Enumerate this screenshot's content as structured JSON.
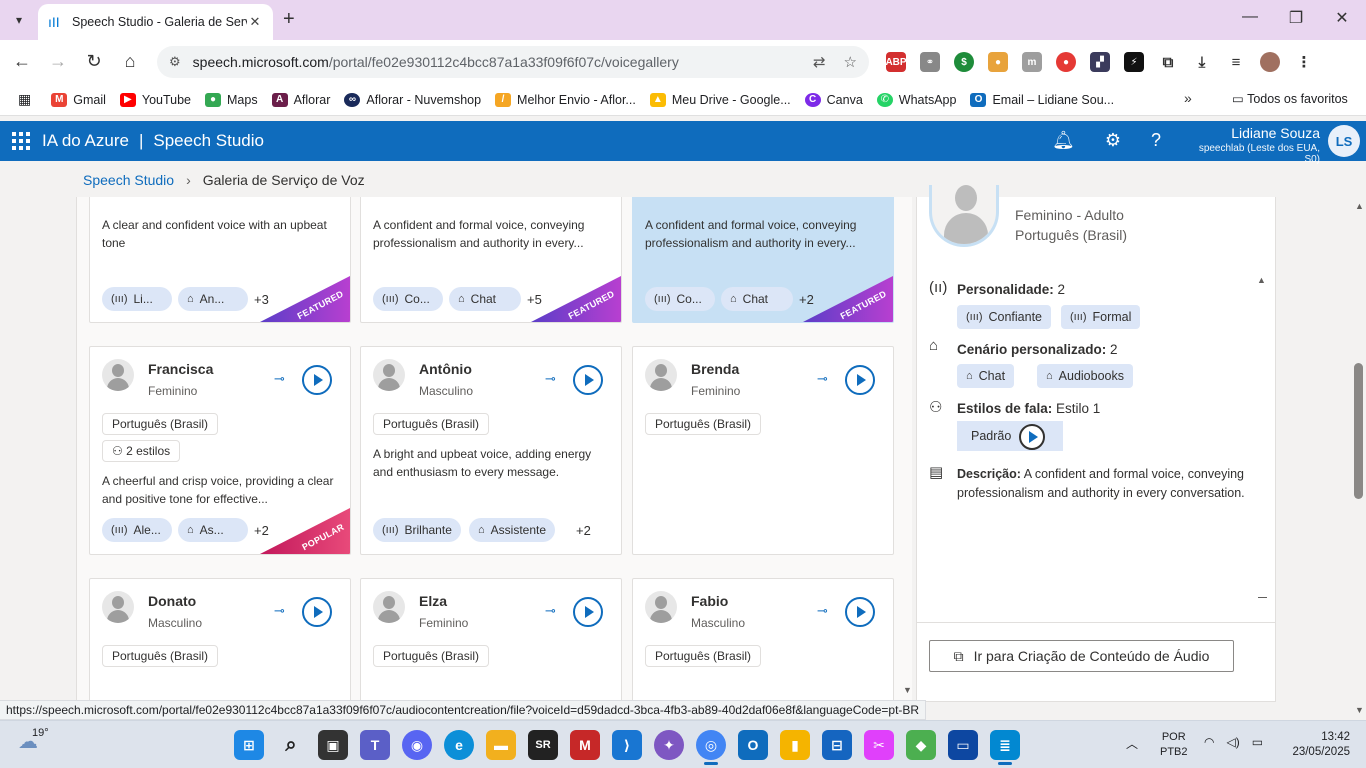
{
  "browser": {
    "tab_title": "Speech Studio - Galeria de Serv",
    "url_host": "speech.microsoft.com",
    "url_path": "/portal/fe02e930112c4bcc87a1a33f09f6f07c/voicegallery",
    "bookmarks": [
      {
        "label": "Gmail",
        "color": "#ea4335",
        "icon": "gmail-icon"
      },
      {
        "label": "YouTube",
        "color": "#ff0000",
        "icon": "youtube-icon"
      },
      {
        "label": "Maps",
        "color": "#34a853",
        "icon": "maps-icon"
      },
      {
        "label": "Aflorar",
        "color": "#6b1e4a",
        "icon": "aflorar-icon"
      },
      {
        "label": "Aflorar - Nuvemshop",
        "color": "#1a2a5a",
        "icon": "nuvemshop-icon"
      },
      {
        "label": "Melhor Envio - Aflor...",
        "color": "#f5a623",
        "icon": "melhor-envio-icon"
      },
      {
        "label": "Meu Drive - Google...",
        "color": "#fbbc04",
        "icon": "drive-icon"
      },
      {
        "label": "Canva",
        "color": "#7d2ae8",
        "icon": "canva-icon"
      },
      {
        "label": "WhatsApp",
        "color": "#25d366",
        "icon": "whatsapp-icon"
      },
      {
        "label": "Email – Lidiane Sou...",
        "color": "#0f6cbd",
        "icon": "outlook-icon"
      }
    ],
    "all_bookmarks": "Todos os favoritos",
    "status_url": "https://speech.microsoft.com/portal/fe02e930112c4bcc87a1a33f09f6f07c/audiocontentcreation/file?voiceId=d59dadcd-3bca-4fb3-ab89-40d2daf06e8f&languageCode=pt-BR"
  },
  "header": {
    "product": "IA do Azure",
    "app": "Speech Studio",
    "user_name": "Lidiane Souza",
    "user_sub": "speechlab (Leste dos EUA, S0)",
    "user_initials": "LS"
  },
  "breadcrumb": {
    "root": "Speech Studio",
    "current": "Galeria de Serviço de Voz"
  },
  "top_cards": [
    {
      "desc": "A clear and confident voice with an upbeat tone",
      "chip1": "Li...",
      "chip2": "An...",
      "more": "+3",
      "ribbon": "FEATURED"
    },
    {
      "desc": "A confident and formal voice, conveying professionalism and authority in every...",
      "chip1": "Co...",
      "chip2": "Chat",
      "more": "+5",
      "ribbon": "FEATURED"
    },
    {
      "desc": "A confident and formal voice, conveying professionalism and authority in every...",
      "chip1": "Co...",
      "chip2": "Chat",
      "more": "+2",
      "ribbon": "FEATURED"
    }
  ],
  "mid_cards": [
    {
      "name": "Francisca",
      "gender": "Feminino",
      "lang": "Português (Brasil)",
      "styles": "2 estilos",
      "desc": "A cheerful and crisp voice, providing a clear and positive tone for effective...",
      "chip1": "Ale...",
      "chip2": "As...",
      "more": "+2",
      "ribbon": "POPULAR"
    },
    {
      "name": "Antônio",
      "gender": "Masculino",
      "lang": "Português (Brasil)",
      "desc": "A bright and upbeat voice, adding energy and enthusiasm to every message.",
      "chip1": "Brilhante",
      "chip2": "Assistente",
      "more": "+2"
    },
    {
      "name": "Brenda",
      "gender": "Feminino",
      "lang": "Português (Brasil)"
    }
  ],
  "bottom_cards": [
    {
      "name": "Donato",
      "gender": "Masculino",
      "lang": "Português (Brasil)"
    },
    {
      "name": "Elza",
      "gender": "Feminino",
      "lang": "Português (Brasil)"
    },
    {
      "name": "Fabio",
      "gender": "Masculino",
      "lang": "Português (Brasil)"
    }
  ],
  "panel": {
    "gender": "Feminino - Adulto",
    "lang": "Português (Brasil)",
    "personality_title": "Personalidade:",
    "personality_count": "2",
    "personality": [
      "Confiante",
      "Formal"
    ],
    "scenario_title": "Cenário personalizado:",
    "scenario_count": "2",
    "scenarios": [
      "Chat",
      "Audiobooks"
    ],
    "styles_title": "Estilos de fala:",
    "styles_count": "Estilo 1",
    "style_name": "Padrão",
    "desc_title": "Descrição:",
    "desc": "A confident and formal voice, conveying professionalism and authority in every conversation.",
    "cta": "Ir para Criação de Conteúdo de Áudio"
  },
  "taskbar": {
    "temp": "19°",
    "lang1": "POR",
    "lang2": "PTB2",
    "time": "13:42",
    "date": "23/05/2025"
  },
  "colors": {
    "azure_blue": "#0f6cbd",
    "featured_gradient": [
      "#5b3ec8",
      "#b83fd0"
    ],
    "popular_gradient": [
      "#c2185b",
      "#e84a7a"
    ]
  }
}
